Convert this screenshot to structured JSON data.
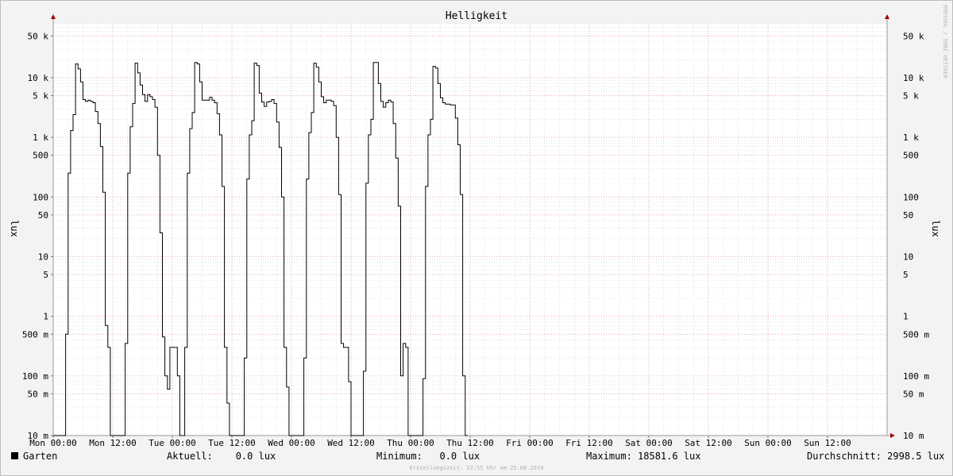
{
  "watermark": "RRDTOOL / TOBI OETIKER",
  "footer": "Erstellungszeit: 23:55 Uhr am 25.08.2019",
  "legend": {
    "series_name": "Garten",
    "current": "Aktuell:    0.0 lux",
    "minimum": "Minimum:   0.0 lux",
    "maximum": "Maximum: 18581.6 lux",
    "average": "Durchschnitt: 2998.5 lux"
  },
  "chart_data": {
    "type": "line",
    "title": "Helligkeit",
    "ylabel": "lux",
    "ylabel_right": "lux",
    "yscale": "log",
    "ylim": [
      0.01,
      80000
    ],
    "xlim": [
      0,
      168
    ],
    "x_unit": "hours since Mon 00:00",
    "grid": true,
    "x_ticks": [
      {
        "x": 0,
        "label": "Mon 00:00"
      },
      {
        "x": 12,
        "label": "Mon 12:00"
      },
      {
        "x": 24,
        "label": "Tue 00:00"
      },
      {
        "x": 36,
        "label": "Tue 12:00"
      },
      {
        "x": 48,
        "label": "Wed 00:00"
      },
      {
        "x": 60,
        "label": "Wed 12:00"
      },
      {
        "x": 72,
        "label": "Thu 00:00"
      },
      {
        "x": 84,
        "label": "Thu 12:00"
      },
      {
        "x": 96,
        "label": "Fri 00:00"
      },
      {
        "x": 108,
        "label": "Fri 12:00"
      },
      {
        "x": 120,
        "label": "Sat 00:00"
      },
      {
        "x": 132,
        "label": "Sat 12:00"
      },
      {
        "x": 144,
        "label": "Sun 00:00"
      },
      {
        "x": 156,
        "label": "Sun 12:00"
      }
    ],
    "y_ticks": [
      {
        "v": 50000,
        "label": "50 k"
      },
      {
        "v": 10000,
        "label": "10 k"
      },
      {
        "v": 5000,
        "label": "5 k"
      },
      {
        "v": 1000,
        "label": "1 k"
      },
      {
        "v": 500,
        "label": "500"
      },
      {
        "v": 100,
        "label": "100"
      },
      {
        "v": 50,
        "label": "50"
      },
      {
        "v": 10,
        "label": "10"
      },
      {
        "v": 5,
        "label": "5"
      },
      {
        "v": 1,
        "label": "1"
      },
      {
        "v": 0.5,
        "label": "500 m"
      },
      {
        "v": 0.1,
        "label": "100 m"
      },
      {
        "v": 0.05,
        "label": "50 m"
      },
      {
        "v": 0.01,
        "label": "10 m"
      }
    ],
    "series": [
      {
        "name": "Garten",
        "color": "#000000",
        "points": [
          [
            0,
            0.01
          ],
          [
            2.5,
            0.01
          ],
          [
            2.5,
            0.5
          ],
          [
            3.0,
            0.5
          ],
          [
            3.0,
            250
          ],
          [
            3.5,
            250
          ],
          [
            3.5,
            1300
          ],
          [
            4.0,
            1300
          ],
          [
            4.0,
            2400
          ],
          [
            4.5,
            2400
          ],
          [
            4.5,
            17000
          ],
          [
            5.0,
            17000
          ],
          [
            5.0,
            14000
          ],
          [
            5.5,
            14000
          ],
          [
            5.5,
            8500
          ],
          [
            6.0,
            8500
          ],
          [
            6.0,
            4300
          ],
          [
            6.5,
            4300
          ],
          [
            6.5,
            4000
          ],
          [
            7.0,
            4000
          ],
          [
            7.0,
            4200
          ],
          [
            7.5,
            4200
          ],
          [
            7.5,
            4000
          ],
          [
            8.0,
            4000
          ],
          [
            8.0,
            3800
          ],
          [
            8.5,
            3800
          ],
          [
            8.5,
            2700
          ],
          [
            9.0,
            2700
          ],
          [
            9.0,
            1700
          ],
          [
            9.5,
            1700
          ],
          [
            9.5,
            700
          ],
          [
            10.0,
            700
          ],
          [
            10.0,
            120
          ],
          [
            10.5,
            120
          ],
          [
            10.5,
            0.7
          ],
          [
            11.0,
            0.7
          ],
          [
            11.0,
            0.3
          ],
          [
            11.5,
            0.3
          ],
          [
            11.5,
            0.01
          ],
          [
            14.5,
            0.01
          ],
          [
            14.5,
            0.35
          ],
          [
            15.0,
            0.35
          ],
          [
            15.0,
            250
          ],
          [
            15.5,
            250
          ],
          [
            15.5,
            1500
          ],
          [
            16.0,
            1500
          ],
          [
            16.0,
            3700
          ],
          [
            16.5,
            3700
          ],
          [
            16.5,
            17500
          ],
          [
            17.0,
            17500
          ],
          [
            17.0,
            12000
          ],
          [
            17.5,
            12000
          ],
          [
            17.5,
            7500
          ],
          [
            18.0,
            7500
          ],
          [
            18.0,
            5200
          ],
          [
            18.5,
            5200
          ],
          [
            18.5,
            4000
          ],
          [
            19.0,
            4000
          ],
          [
            19.0,
            5200
          ],
          [
            19.5,
            5200
          ],
          [
            19.5,
            4800
          ],
          [
            20.0,
            4800
          ],
          [
            20.0,
            4300
          ],
          [
            20.5,
            4300
          ],
          [
            20.5,
            3200
          ],
          [
            21.0,
            3200
          ],
          [
            21.0,
            500
          ],
          [
            21.5,
            500
          ],
          [
            21.5,
            25
          ],
          [
            22.0,
            25
          ],
          [
            22.0,
            0.45
          ],
          [
            22.5,
            0.45
          ],
          [
            22.5,
            0.1
          ],
          [
            23.0,
            0.1
          ],
          [
            23.0,
            0.06
          ],
          [
            23.5,
            0.06
          ],
          [
            23.5,
            0.3
          ],
          [
            25.0,
            0.3
          ],
          [
            25.0,
            0.1
          ],
          [
            25.5,
            0.1
          ],
          [
            25.5,
            0.01
          ],
          [
            26.5,
            0.01
          ],
          [
            26.5,
            0.3
          ],
          [
            27.0,
            0.3
          ],
          [
            27.0,
            250
          ],
          [
            27.5,
            250
          ],
          [
            27.5,
            1400
          ],
          [
            28.0,
            1400
          ],
          [
            28.0,
            2600
          ],
          [
            28.5,
            2600
          ],
          [
            28.5,
            18000
          ],
          [
            29.0,
            18000
          ],
          [
            29.0,
            17000
          ],
          [
            29.5,
            17000
          ],
          [
            29.5,
            8500
          ],
          [
            30.0,
            8500
          ],
          [
            30.0,
            4200
          ],
          [
            31.5,
            4200
          ],
          [
            31.5,
            4700
          ],
          [
            32.0,
            4700
          ],
          [
            32.0,
            4200
          ],
          [
            32.5,
            4200
          ],
          [
            32.5,
            3800
          ],
          [
            33.0,
            3800
          ],
          [
            33.0,
            2500
          ],
          [
            33.5,
            2500
          ],
          [
            33.5,
            1100
          ],
          [
            34.0,
            1100
          ],
          [
            34.0,
            150
          ],
          [
            34.5,
            150
          ],
          [
            34.5,
            0.3
          ],
          [
            35.0,
            0.3
          ],
          [
            35.0,
            0.035
          ],
          [
            35.5,
            0.035
          ],
          [
            35.5,
            0.01
          ],
          [
            38.5,
            0.01
          ],
          [
            38.5,
            0.2
          ],
          [
            39.0,
            0.2
          ],
          [
            39.0,
            200
          ],
          [
            39.5,
            200
          ],
          [
            39.5,
            1100
          ],
          [
            40.0,
            1100
          ],
          [
            40.0,
            1900
          ],
          [
            40.5,
            1900
          ],
          [
            40.5,
            17500
          ],
          [
            41.0,
            17500
          ],
          [
            41.0,
            16000
          ],
          [
            41.5,
            16000
          ],
          [
            41.5,
            5500
          ],
          [
            42.0,
            5500
          ],
          [
            42.0,
            3900
          ],
          [
            42.5,
            3900
          ],
          [
            42.5,
            3300
          ],
          [
            43.0,
            3300
          ],
          [
            43.0,
            3900
          ],
          [
            43.5,
            3900
          ],
          [
            43.5,
            4000
          ],
          [
            44.0,
            4000
          ],
          [
            44.0,
            4300
          ],
          [
            44.5,
            4300
          ],
          [
            44.5,
            3700
          ],
          [
            45.0,
            3700
          ],
          [
            45.0,
            1800
          ],
          [
            45.5,
            1800
          ],
          [
            45.5,
            680
          ],
          [
            46.0,
            680
          ],
          [
            46.0,
            100
          ],
          [
            46.5,
            100
          ],
          [
            46.5,
            0.3
          ],
          [
            47.0,
            0.3
          ],
          [
            47.0,
            0.065
          ],
          [
            47.5,
            0.065
          ],
          [
            47.5,
            0.01
          ],
          [
            50.5,
            0.01
          ],
          [
            50.5,
            0.2
          ],
          [
            51.0,
            0.2
          ],
          [
            51.0,
            200
          ],
          [
            51.5,
            200
          ],
          [
            51.5,
            1200
          ],
          [
            52.0,
            1200
          ],
          [
            52.0,
            2600
          ],
          [
            52.5,
            2600
          ],
          [
            52.5,
            17500
          ],
          [
            53.0,
            17500
          ],
          [
            53.0,
            15000
          ],
          [
            53.5,
            15000
          ],
          [
            53.5,
            8500
          ],
          [
            54.0,
            8500
          ],
          [
            54.0,
            4800
          ],
          [
            54.5,
            4800
          ],
          [
            54.5,
            3800
          ],
          [
            55.0,
            3800
          ],
          [
            55.0,
            4200
          ],
          [
            56.0,
            4200
          ],
          [
            56.0,
            4000
          ],
          [
            56.5,
            4000
          ],
          [
            56.5,
            3400
          ],
          [
            57.0,
            3400
          ],
          [
            57.0,
            1000
          ],
          [
            57.5,
            1000
          ],
          [
            57.5,
            110
          ],
          [
            58.0,
            110
          ],
          [
            58.0,
            0.35
          ],
          [
            58.5,
            0.35
          ],
          [
            58.5,
            0.3
          ],
          [
            59.5,
            0.3
          ],
          [
            59.5,
            0.08
          ],
          [
            60.0,
            0.08
          ],
          [
            60.0,
            0.01
          ],
          [
            62.5,
            0.01
          ],
          [
            62.5,
            0.12
          ],
          [
            63.0,
            0.12
          ],
          [
            63.0,
            170
          ],
          [
            63.5,
            170
          ],
          [
            63.5,
            1100
          ],
          [
            64.0,
            1100
          ],
          [
            64.0,
            2000
          ],
          [
            64.5,
            2000
          ],
          [
            64.5,
            18000
          ],
          [
            65.5,
            18000
          ],
          [
            65.5,
            8000
          ],
          [
            66.0,
            8000
          ],
          [
            66.0,
            4000
          ],
          [
            66.5,
            4000
          ],
          [
            66.5,
            3200
          ],
          [
            67.0,
            3200
          ],
          [
            67.0,
            3800
          ],
          [
            67.5,
            3800
          ],
          [
            67.5,
            4200
          ],
          [
            68.0,
            4200
          ],
          [
            68.0,
            3900
          ],
          [
            68.5,
            3900
          ],
          [
            68.5,
            1700
          ],
          [
            69.0,
            1700
          ],
          [
            69.0,
            450
          ],
          [
            69.5,
            450
          ],
          [
            69.5,
            70
          ],
          [
            70.0,
            70
          ],
          [
            70.0,
            0.1
          ],
          [
            70.5,
            0.1
          ],
          [
            70.5,
            0.35
          ],
          [
            71.0,
            0.35
          ],
          [
            71.0,
            0.3
          ],
          [
            71.5,
            0.3
          ],
          [
            71.5,
            0.01
          ],
          [
            74.5,
            0.01
          ],
          [
            74.5,
            0.09
          ],
          [
            75.0,
            0.09
          ],
          [
            75.0,
            150
          ],
          [
            75.5,
            150
          ],
          [
            75.5,
            1100
          ],
          [
            76.0,
            1100
          ],
          [
            76.0,
            2000
          ],
          [
            76.5,
            2000
          ],
          [
            76.5,
            15500
          ],
          [
            77.0,
            15500
          ],
          [
            77.0,
            14500
          ],
          [
            77.5,
            14500
          ],
          [
            77.5,
            8000
          ],
          [
            78.0,
            8000
          ],
          [
            78.0,
            4600
          ],
          [
            78.5,
            4600
          ],
          [
            78.5,
            3800
          ],
          [
            79.0,
            3800
          ],
          [
            79.0,
            3600
          ],
          [
            80.0,
            3600
          ],
          [
            80.0,
            3500
          ],
          [
            81.0,
            3500
          ],
          [
            81.0,
            2100
          ],
          [
            81.5,
            2100
          ],
          [
            81.5,
            750
          ],
          [
            82.0,
            750
          ],
          [
            82.0,
            110
          ],
          [
            82.5,
            110
          ],
          [
            82.5,
            0.1
          ],
          [
            83.0,
            0.1
          ],
          [
            83.0,
            0.01
          ],
          [
            83.5,
            0.01
          ]
        ]
      }
    ]
  }
}
